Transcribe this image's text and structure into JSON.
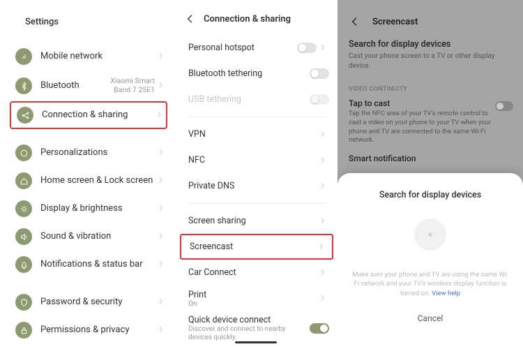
{
  "panel1": {
    "title": "Settings",
    "items": [
      {
        "label": "Mobile network",
        "sub": ""
      },
      {
        "label": "Bluetooth",
        "sub": "Xiaomi Smart Band 7 25E1"
      },
      {
        "label": "Connection & sharing",
        "sub": "",
        "highlight": true
      },
      {
        "label": "Personalizations",
        "sub": ""
      },
      {
        "label": "Home screen & Lock screen",
        "sub": ""
      },
      {
        "label": "Display & brightness",
        "sub": ""
      },
      {
        "label": "Sound & vibration",
        "sub": ""
      },
      {
        "label": "Notifications & status bar",
        "sub": ""
      },
      {
        "label": "Password & security",
        "sub": ""
      },
      {
        "label": "Permissions & privacy",
        "sub": ""
      }
    ]
  },
  "panel2": {
    "title": "Connection & sharing",
    "items": {
      "hotspot": "Personal hotspot",
      "bt_tether": "Bluetooth tethering",
      "usb_tether": "USB tethering",
      "vpn": "VPN",
      "nfc": "NFC",
      "dns": "Private DNS",
      "screen_sharing": "Screen sharing",
      "screencast": "Screencast",
      "car": "Car Connect",
      "print": "Print",
      "print_sub": "On",
      "quick": "Quick device connect",
      "quick_sub": "Discover and connect to nearby devices quickly."
    }
  },
  "panel3": {
    "title": "Screencast",
    "search_title": "Search for display devices",
    "search_desc": "Cast your phone screen to a TV or other display device.",
    "section": "VIDEO CONTINUITY",
    "tap_title": "Tap to cast",
    "tap_desc": "Tap the NFC area of your TV's remote control to cast a video on your phone to your TV when your phone and TV are connected to the same Wi-Fi network.",
    "smart": "Smart notification",
    "sheet": {
      "title": "Search for display devices",
      "help": "Make sure your phone and TV are using the same Wi-Fi network and your TV's wireless display function is turned on. ",
      "help_link": "View help",
      "cancel": "Cancel"
    }
  }
}
